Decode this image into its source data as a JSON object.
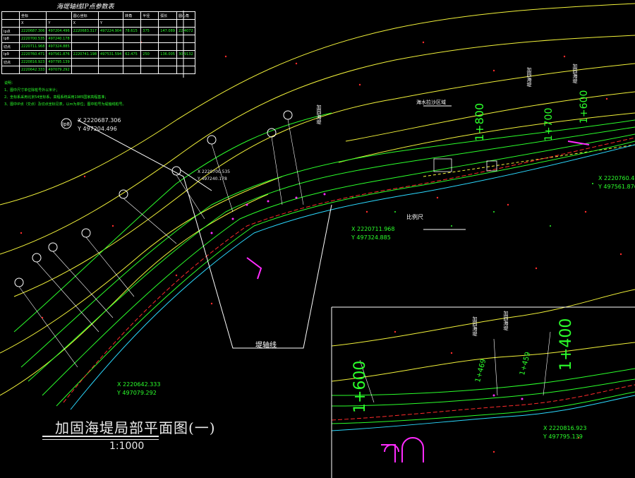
{
  "drawing": {
    "title": "加固海堤局部平面图(一)",
    "scale": "1:1000",
    "table_title": "海堤轴线IP点参数表",
    "axis_label": "堤轴线",
    "scale_bar_label": "比例尺",
    "area_label": "海水拉沙区域",
    "colors": {
      "background": "#000000",
      "contour": "#f2f23a",
      "green": "#2bff2b",
      "red": "#ff2b2b",
      "magenta": "#ff2bff",
      "white": "#ffffff",
      "cyan": "#2bd9ff"
    }
  },
  "table": {
    "header": [
      "",
      "坐标",
      "",
      "圆心坐标",
      "",
      "转角",
      "半径",
      "弧长",
      "圆心角"
    ],
    "subheader": [
      "",
      "X",
      "Y",
      "X",
      "Y",
      "",
      "",
      "",
      ""
    ],
    "rows": [
      [
        "Ip点",
        "2220687.306",
        "497204.496",
        "2220683.317",
        "497224.904",
        "78.615",
        "375",
        "147.089",
        "22.4072"
      ],
      [
        "Ip8",
        "2220700.535",
        "497240.178",
        "",
        "",
        "",
        "",
        "",
        ""
      ],
      [
        "切点",
        "2220711.968",
        "497324.885",
        "",
        "",
        "",
        "",
        "",
        ""
      ],
      [
        "Ip9",
        "2220760.471",
        "497561.876",
        "2220741.198",
        "497531.594",
        "62.475",
        "250",
        "136.005",
        "30.9132"
      ],
      [
        "切点",
        "2220816.923",
        "497795.139",
        "",
        "",
        "",
        "",
        "",
        ""
      ],
      [
        "",
        "2220642.333",
        "497079.292",
        "",
        "",
        "",
        "",
        "",
        ""
      ]
    ]
  },
  "notes": [
    "说明：",
    "1、图中尺寸单位除桩号外以米计；",
    "2、坐标系采用北京54坐标系，高程系统采用1985国家高程基准；",
    "3、图中IP点（交点）及切点坐标见表，以m为单位；图中桩号为堤轴线桩号。"
  ],
  "coords": {
    "ip8_x": "X 2220687.306",
    "ip8_y": "Y 497204.496",
    "ip_b_x": "X 2220700.535",
    "ip_b_y": "Y 497240.178",
    "mid_x": "X 2220711.968",
    "mid_y": "Y 497324.885",
    "right_x": "X 2220760.471",
    "right_y": "Y 497561.876",
    "bottom_x": "X 2220642.333",
    "bottom_y": "Y 497079.292",
    "inset_x": "X 2220816.923",
    "inset_y": "Y 497795.139"
  },
  "ip_label": "Ip8",
  "chainages": {
    "c1": "1+800",
    "c2": "1+700",
    "c3": "1+600",
    "inset_left": "1+600",
    "inset_right": "1+400",
    "inset_a": "1+469",
    "inset_b": "1+459"
  },
  "vertical_labels": {
    "v1": "加固海堤",
    "v2": "加固海堤",
    "v3": "加固海堤",
    "v4": "加固海堤",
    "v5": "加固海堤"
  }
}
